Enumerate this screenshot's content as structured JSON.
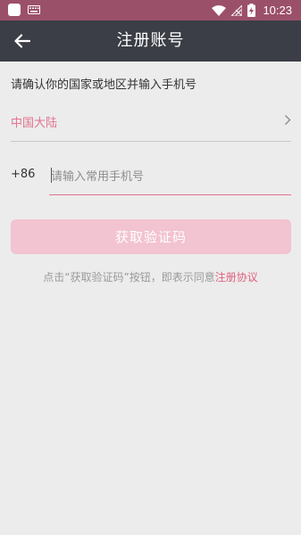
{
  "status_bar": {
    "time": "10:23",
    "icons": [
      "app-icon",
      "keyboard-icon",
      "wifi-icon",
      "no-signal-icon",
      "battery-charging-icon"
    ],
    "color": "#9b5069"
  },
  "app_bar": {
    "title": "注册账号",
    "back_icon": "arrow-left-icon",
    "color": "#3b3e46"
  },
  "form": {
    "prompt": "请确认你的国家或地区并输入手机号",
    "region": "中国大陆",
    "country_code": "+86",
    "phone_placeholder": "请输入常用手机号",
    "phone_value": "",
    "submit_label": "获取验证码",
    "agreement_prefix": "点击“获取验证码”按钮，即表示同意",
    "agreement_link": "注册协议",
    "accent_color": "#e2738f",
    "button_color": "#f2c3d0"
  }
}
